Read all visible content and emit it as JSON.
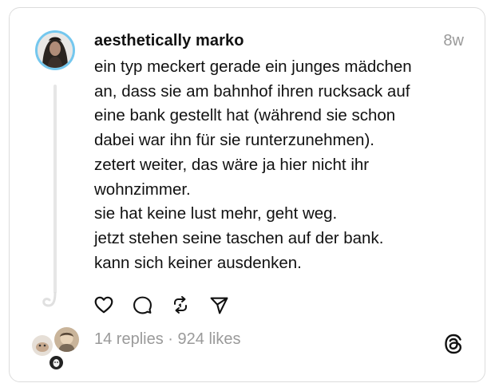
{
  "post": {
    "username": "aesthetically marko",
    "timestamp": "8w",
    "lines": [
      "ein typ meckert gerade ein junges mädchen",
      "an, dass sie am bahnhof ihren rucksack auf",
      "eine bank gestellt hat (während sie schon",
      "dabei war ihn für sie runterzunehmen).",
      "zetert weiter, das wäre ja hier nicht ihr",
      "wohnzimmer.",
      "sie hat keine lust mehr, geht weg.",
      "jetzt stehen seine taschen auf der bank.",
      "kann sich keiner ausdenken."
    ]
  },
  "actions": {
    "icons": [
      "heart-icon",
      "comment-icon",
      "repost-icon",
      "share-icon"
    ]
  },
  "stats": {
    "replies": "14 replies",
    "separator": "·",
    "likes": "924 likes"
  },
  "colors": {
    "avatar_ring": "#74c7ee",
    "text": "#111111",
    "muted": "#9a9a9a",
    "border": "#dcdcdc"
  }
}
